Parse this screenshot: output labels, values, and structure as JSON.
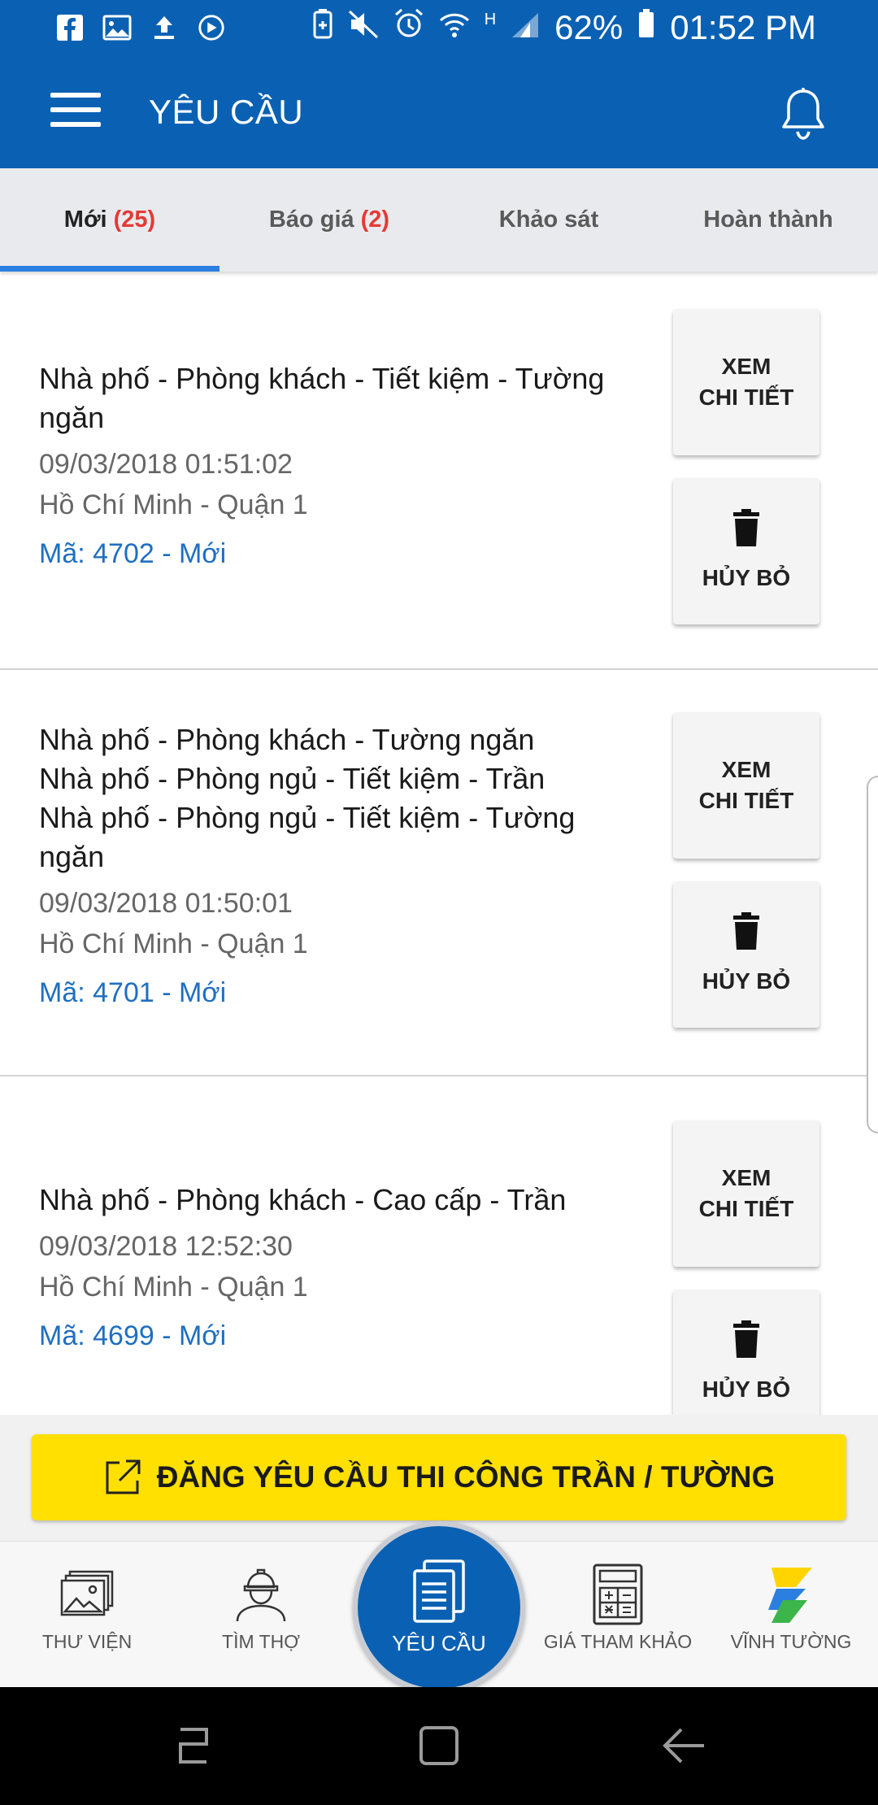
{
  "status_bar": {
    "battery_percent": "62%",
    "time": "01:52 PM",
    "network_label": "H"
  },
  "app_bar": {
    "title": "YÊU CẦU"
  },
  "tabs": [
    {
      "label": "Mới",
      "count": "(25)",
      "active": true
    },
    {
      "label": "Báo giá",
      "count": "(2)",
      "active": false
    },
    {
      "label": "Khảo sát",
      "count": "",
      "active": false
    },
    {
      "label": "Hoàn thành",
      "count": "",
      "active": false
    }
  ],
  "requests": [
    {
      "title_lines": [
        "Nhà phố - Phòng khách - Tiết kiệm - Tường",
        "ngăn"
      ],
      "date": "09/03/2018 01:51:02",
      "location": "Hồ Chí Minh - Quận 1",
      "code": "Mã: 4702 - Mới"
    },
    {
      "title_lines": [
        "Nhà phố - Phòng khách - Tường ngăn",
        "Nhà phố - Phòng ngủ - Tiết kiệm - Trần",
        "Nhà phố - Phòng ngủ - Tiết kiệm - Tường",
        "ngăn"
      ],
      "date": "09/03/2018 01:50:01",
      "location": "Hồ Chí Minh - Quận 1",
      "code": "Mã: 4701 - Mới"
    },
    {
      "title_lines": [
        "Nhà phố - Phòng khách - Cao cấp - Trần"
      ],
      "date": "09/03/2018 12:52:30",
      "location": "Hồ Chí Minh - Quận 1",
      "code": "Mã: 4699 - Mới"
    }
  ],
  "actions": {
    "view_line1": "XEM",
    "view_line2": "CHI TIẾT",
    "cancel": "HỦY BỎ"
  },
  "cta": {
    "label": "ĐĂNG YÊU CẦU THI CÔNG TRẦN / TƯỜNG"
  },
  "bottom_nav": [
    {
      "label": "THƯ VIỆN",
      "icon": "gallery-icon"
    },
    {
      "label": "TÌM THỢ",
      "icon": "worker-icon"
    },
    {
      "label": "YÊU CẦU",
      "icon": "documents-icon",
      "active": true
    },
    {
      "label": "GIÁ THAM KHẢO",
      "icon": "calculator-icon"
    },
    {
      "label": "VĨNH TƯỜNG",
      "icon": "brand-logo-icon"
    }
  ],
  "colors": {
    "primary": "#0a61b3",
    "accent_yellow": "#ffe000",
    "count_red": "#e53935",
    "code_blue": "#1f6fc0"
  }
}
